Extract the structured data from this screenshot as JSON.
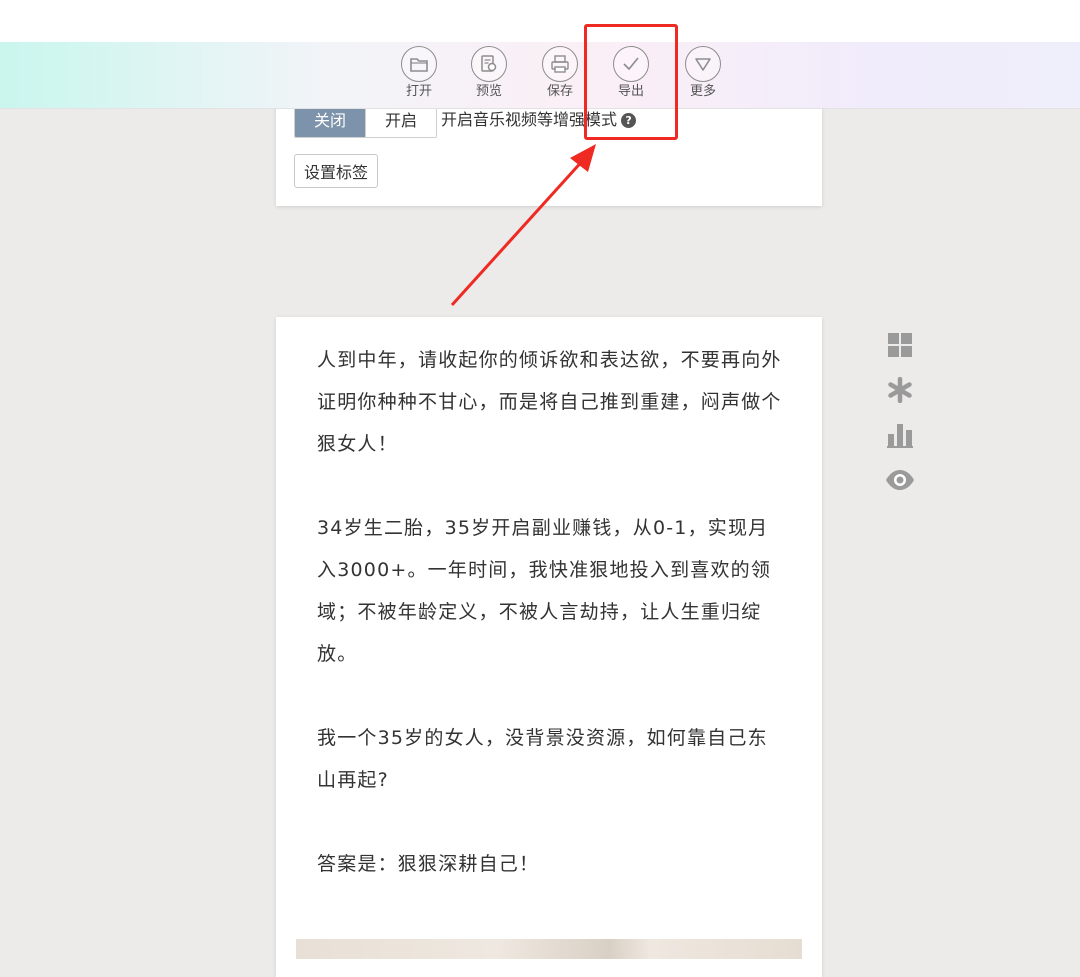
{
  "toolbar": {
    "items": [
      {
        "label": "打开",
        "icon": "folder-icon"
      },
      {
        "label": "预览",
        "icon": "preview-icon"
      },
      {
        "label": "保存",
        "icon": "save-icon"
      },
      {
        "label": "导出",
        "icon": "check-icon"
      },
      {
        "label": "更多",
        "icon": "chevron-down-icon"
      }
    ]
  },
  "settings_card": {
    "toggle_off": "关闭",
    "toggle_on": "开启",
    "mode_label": "开启音乐视频等增强模式",
    "help_glyph": "?",
    "tag_button": "设置标签"
  },
  "article": {
    "paragraphs": [
      "人到中年，请收起你的倾诉欲和表达欲，不要再向外证明你种种不甘心，而是将自己推到重建，闷声做个狠女人！",
      "34岁生二胎，35岁开启副业赚钱，从0-1，实现月入3000+。一年时间，我快准狠地投入到喜欢的领域；不被年龄定义，不被人言劫持，让人生重归绽放。",
      "我一个35岁的女人，没背景没资源，如何靠自己东山再起?",
      "答案是：狠狠深耕自己！"
    ]
  },
  "side_tools": [
    "grid-icon",
    "asterisk-icon",
    "bar-chart-icon",
    "eye-icon"
  ],
  "colors": {
    "highlight": "#ee2a22",
    "toggle_active": "#7d93ab",
    "background": "#ecebea"
  }
}
